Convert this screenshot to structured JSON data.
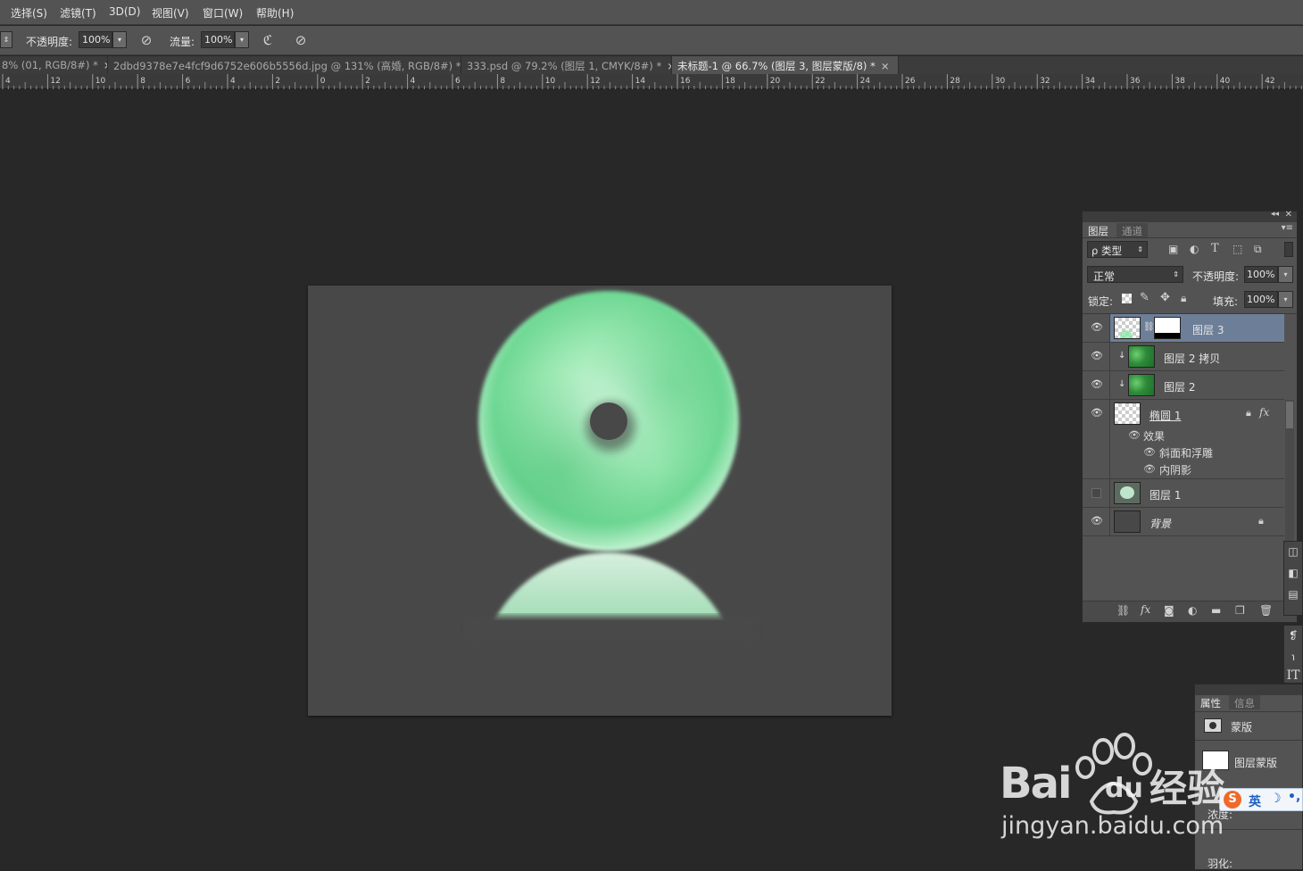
{
  "menu": [
    "选择(S)",
    "滤镜(T)",
    "3D(D)",
    "视图(V)",
    "窗口(W)",
    "帮助(H)"
  ],
  "options": {
    "opacity_label": "不透明度:",
    "opacity_value": "100%",
    "flow_label": "流量:",
    "flow_value": "100%"
  },
  "tabs": [
    {
      "label": "8% (01, RGB/8#) *",
      "close": "×"
    },
    {
      "label": "2dbd9378e7e4fcf9d6752e606b5556d.jpg @ 131% (高婚, RGB/8#) *",
      "close": "×"
    },
    {
      "label": "333.psd @ 79.2% (图层 1, CMYK/8#) *",
      "close": "×"
    },
    {
      "label": "未标题-1 @ 66.7% (图层 3, 图层蒙版/8) *",
      "close": "×"
    }
  ],
  "ruler_labels": [
    "4",
    "12",
    "10",
    "8",
    "6",
    "4",
    "2",
    "0",
    "2",
    "4",
    "6",
    "8",
    "10",
    "12",
    "14",
    "16",
    "18",
    "20",
    "22",
    "24",
    "26",
    "28",
    "30",
    "32",
    "34",
    "36",
    "38",
    "40",
    "42"
  ],
  "layers_panel": {
    "tabs": [
      "图层",
      "通道"
    ],
    "filter_label": "ρ 类型",
    "blend_mode": "正常",
    "opacity_label": "不透明度:",
    "opacity_value": "100%",
    "lock_label": "锁定:",
    "fill_label": "填充:",
    "fill_value": "100%",
    "layers": [
      {
        "name": "图层 3",
        "selected": true
      },
      {
        "name": "图层 2 拷贝"
      },
      {
        "name": "图层 2"
      },
      {
        "name": "椭圆 1",
        "fx": "fx"
      },
      {
        "name": "图层 1"
      },
      {
        "name": "背景"
      }
    ],
    "effects_label": "效果",
    "effects": [
      "斜面和浮雕",
      "内阴影"
    ]
  },
  "properties_panel": {
    "tabs": [
      "属性",
      "信息"
    ],
    "mask_label": "蒙版",
    "layer_mask_label": "图层蒙版",
    "density_label": "浓度:",
    "feather_label": "羽化:"
  },
  "ime": {
    "label": "英"
  },
  "watermark": {
    "brand": "Bai",
    "brand2": "du",
    "cn": "经验",
    "url": "jingyan.baidu.com"
  },
  "colors": {
    "selected_layer": "#6d7f98",
    "jade": "#8ee8a8",
    "canvas": "#484848"
  }
}
